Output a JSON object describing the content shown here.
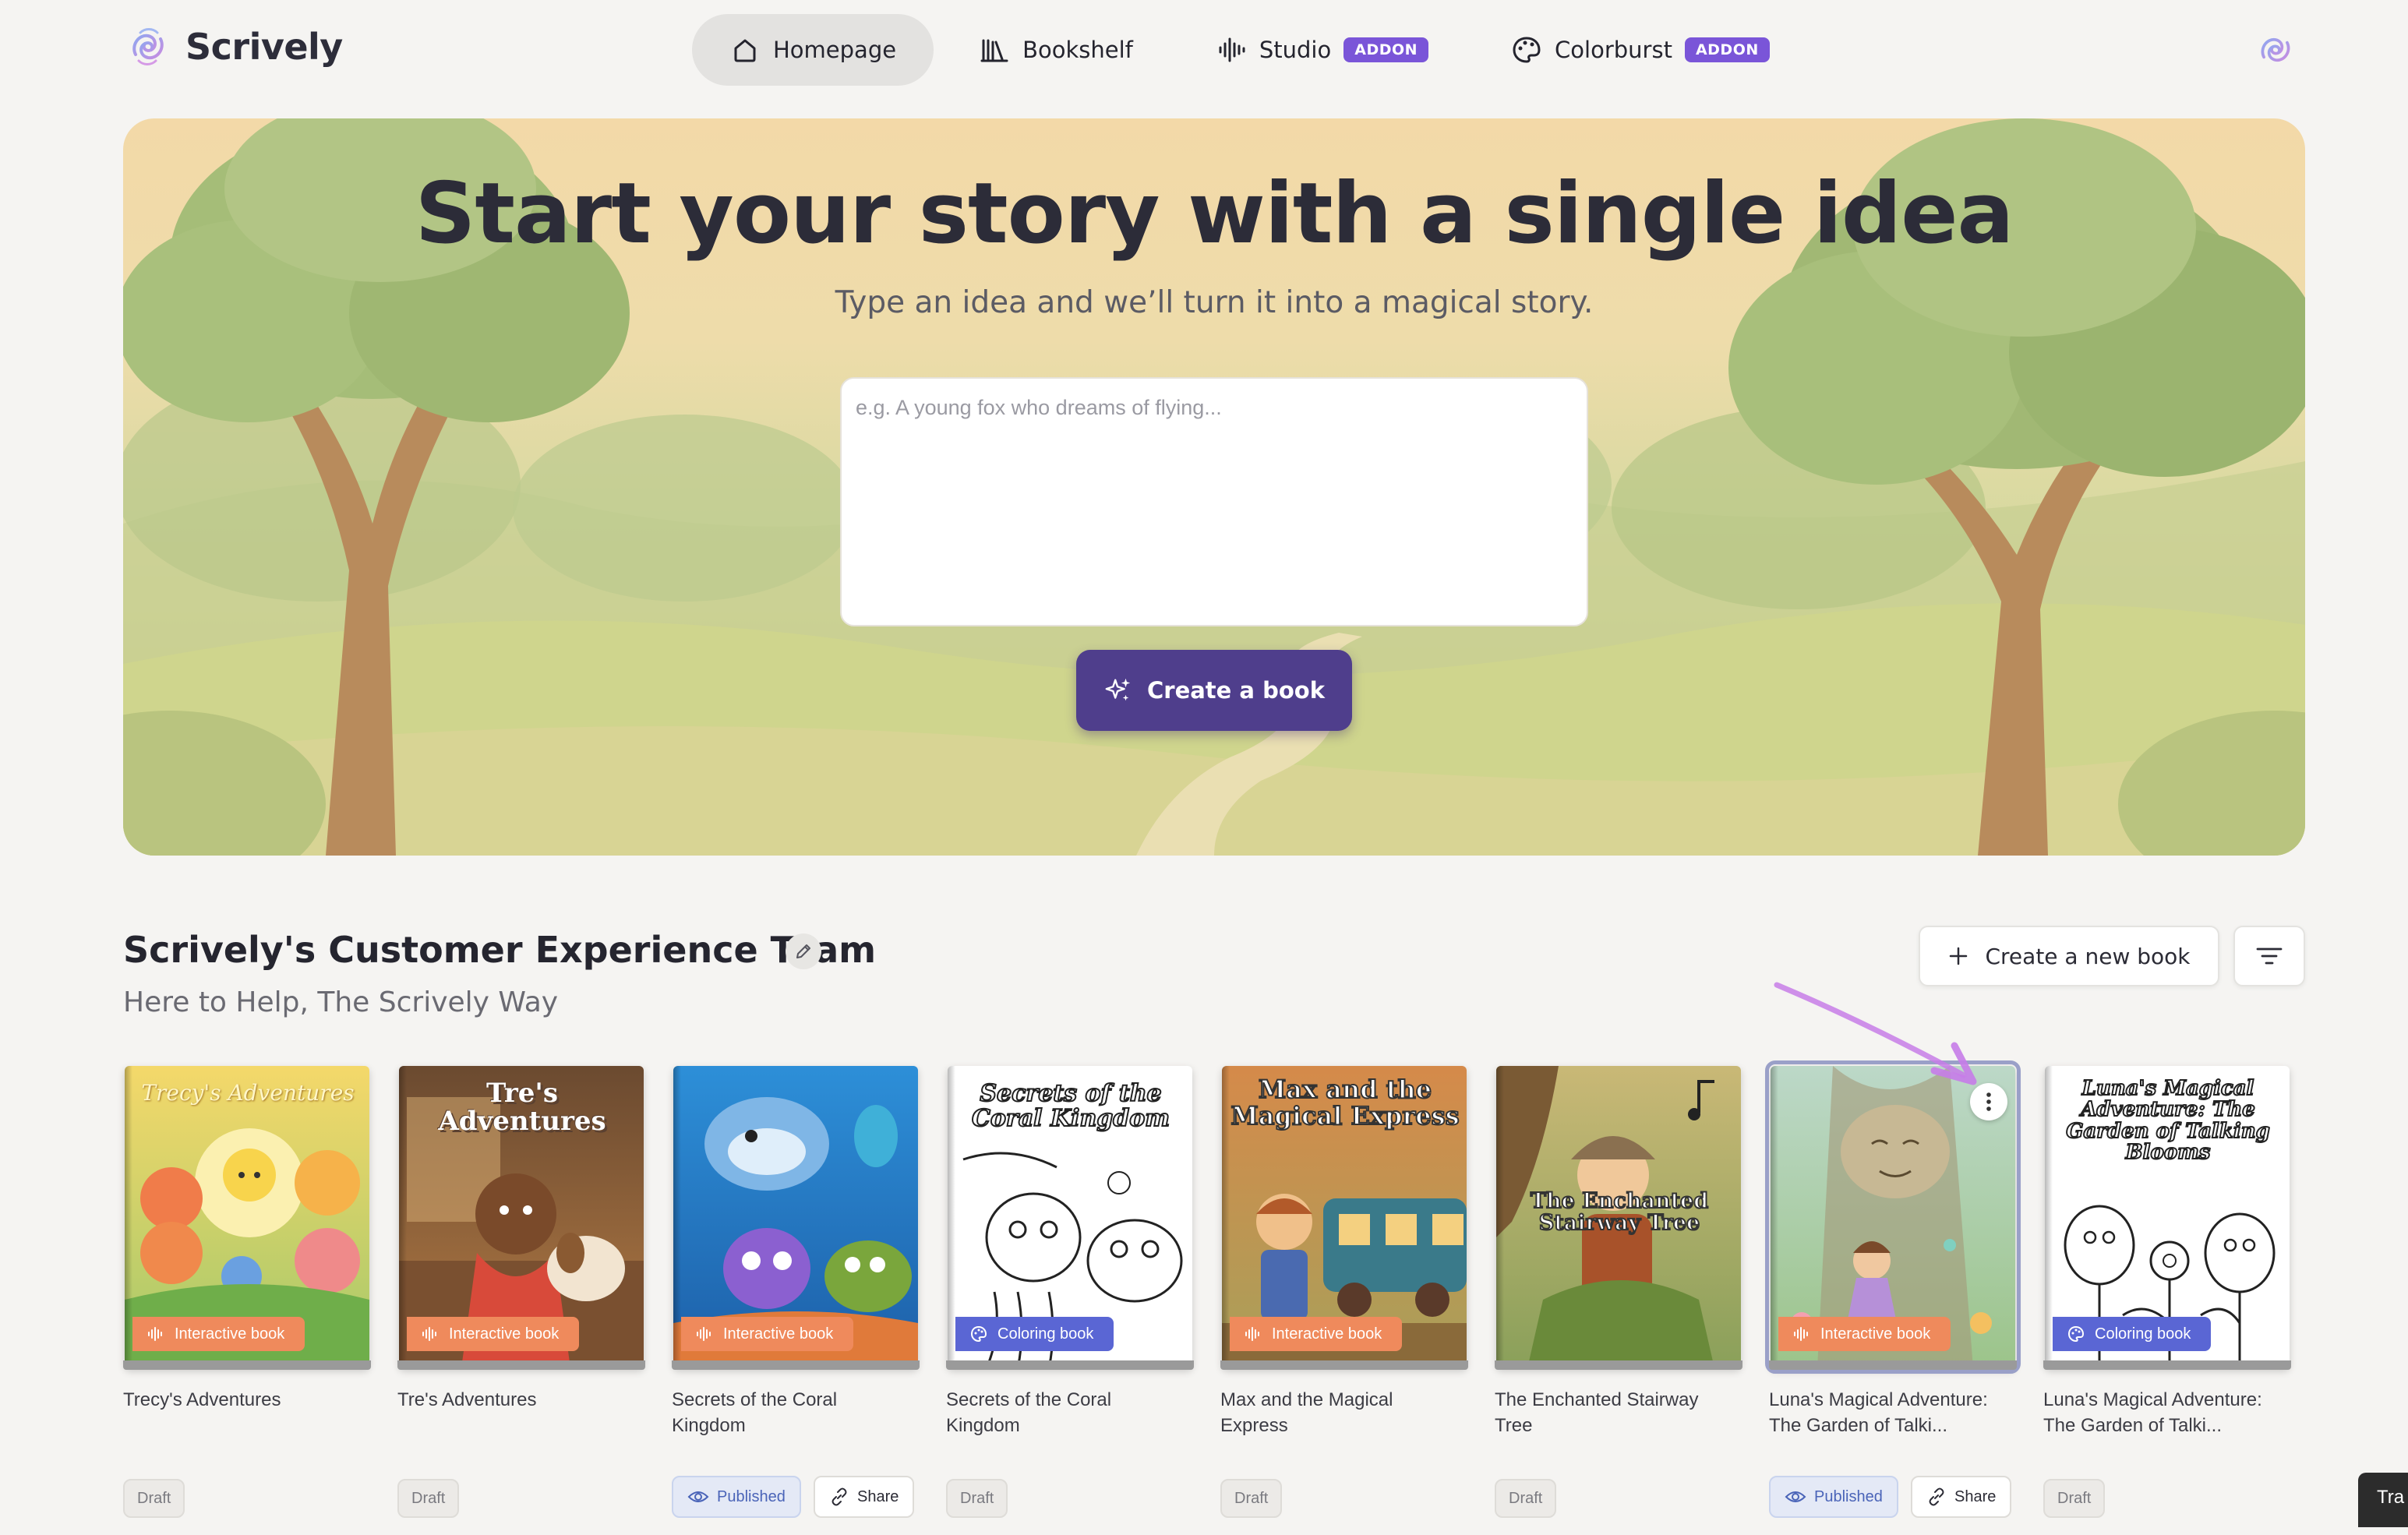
{
  "app": {
    "name": "Scrively"
  },
  "nav": {
    "items": [
      {
        "label": "Homepage",
        "active": true
      },
      {
        "label": "Bookshelf",
        "active": false
      },
      {
        "label": "Studio",
        "badge": "ADDON",
        "active": false
      },
      {
        "label": "Colorburst",
        "badge": "ADDON",
        "active": false
      }
    ]
  },
  "hero": {
    "title": "Start your story with a single idea",
    "subtitle": "Type an idea and we’ll turn it into a magical story.",
    "input_placeholder": "e.g. A young fox who dreams of flying...",
    "input_value": "",
    "create_button": "Create a book"
  },
  "section": {
    "title": "Scrively's Customer Experience Team",
    "subtitle": "Here to Help, The Scrively Way",
    "new_book_button": "Create a new book"
  },
  "books": [
    {
      "title": "Trecy's Adventures",
      "cover_text": "Trecy's Adventures",
      "type": "Interactive book",
      "status": "Draft"
    },
    {
      "title": "Tre's Adventures",
      "cover_text": "Tre's Adventures",
      "type": "Interactive book",
      "status": "Draft"
    },
    {
      "title": "Secrets of the Coral Kingdom",
      "cover_text": "",
      "type": "Interactive book",
      "status": "Published",
      "share": "Share"
    },
    {
      "title": "Secrets of the Coral Kingdom",
      "cover_text": "Secrets of the Coral Kingdom",
      "type": "Coloring book",
      "status": "Draft"
    },
    {
      "title": "Max and the Magical Express",
      "cover_text": "Max and the Magical Express",
      "type": "Interactive book",
      "status": "Draft"
    },
    {
      "title": "The Enchanted Stairway Tree",
      "cover_text": "The Enchanted Stairway Tree",
      "type": "",
      "status": "Draft"
    },
    {
      "title": "Luna's Magical Adventure: The Garden of Talki...",
      "cover_text": "",
      "type": "Interactive book",
      "status": "Published",
      "share": "Share"
    },
    {
      "title": "Luna's Magical Adventure: The Garden of Talki...",
      "cover_text": "Luna's Magical Adventure: The Garden of Talking Blooms",
      "type": "Coloring book",
      "status": "Draft"
    }
  ],
  "corner_tab": {
    "label": "Tra"
  },
  "colors": {
    "accent": "#4f3e8c",
    "addon_badge": "#7a55d8",
    "interactive_badge": "#ef8a5c",
    "coloring_badge": "#5a66d4",
    "published": "#4a64b8",
    "annotation_arrow": "#c77ce8"
  },
  "icons": {
    "logo": "scrively-swirl-icon",
    "homepage": "home-icon",
    "bookshelf": "bookshelf-icon",
    "studio": "audio-wave-icon",
    "colorburst": "palette-icon",
    "create": "sparkles-icon",
    "edit": "pencil-icon",
    "new_book": "plus-icon",
    "filter": "filter-lines-icon",
    "interactive": "audio-wave-icon",
    "coloring": "palette-icon",
    "published": "eye-icon",
    "share": "link-icon",
    "more": "more-vertical-icon"
  }
}
